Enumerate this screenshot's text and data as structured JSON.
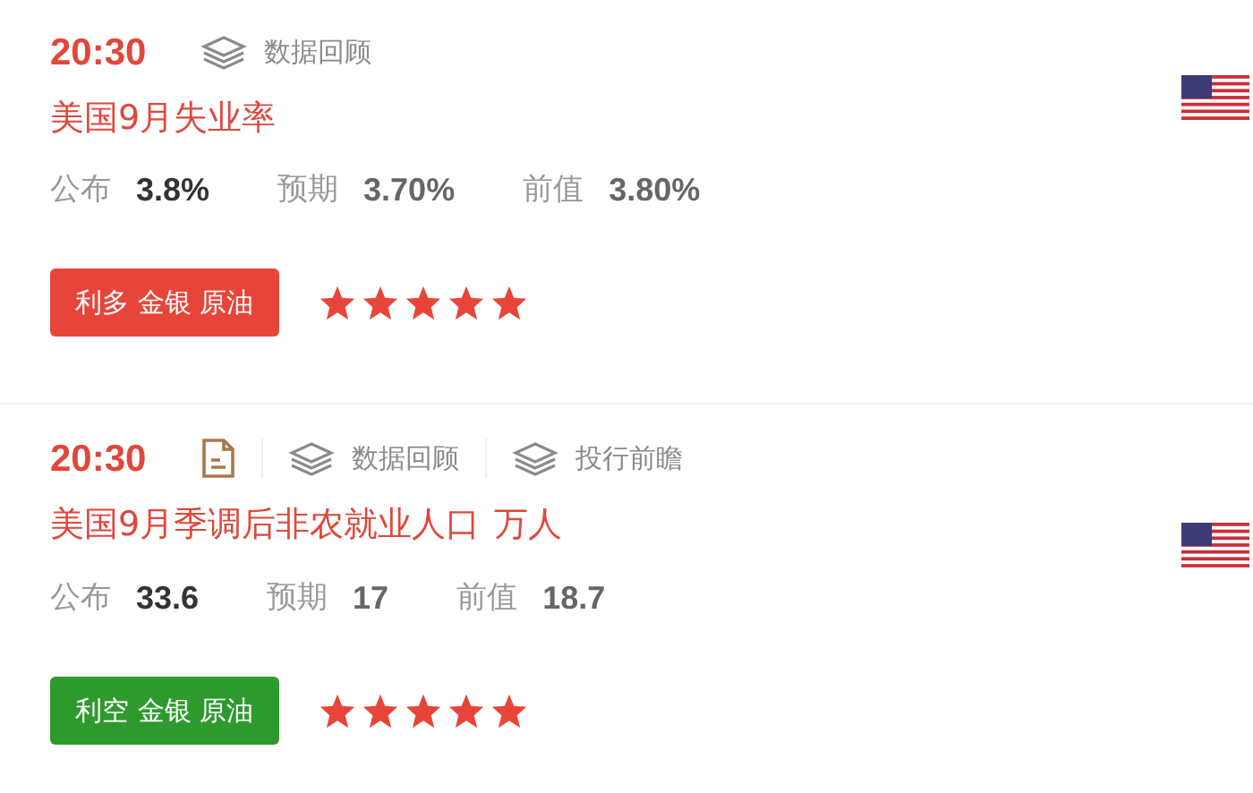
{
  "events": [
    {
      "time": "20:30",
      "links": [
        {
          "kind": "review",
          "label": "数据回顾"
        }
      ],
      "title": "美国9月失业率",
      "stats": [
        {
          "label": "公布",
          "value": "3.8%",
          "kind": "actual"
        },
        {
          "label": "预期",
          "value": "3.70%",
          "kind": "other"
        },
        {
          "label": "前值",
          "value": "3.80%",
          "kind": "other"
        }
      ],
      "tag": {
        "label": "利多 金银 原油",
        "kind": "bullish"
      },
      "stars": 5
    },
    {
      "time": "20:30",
      "links": [
        {
          "kind": "doc"
        },
        {
          "kind": "review",
          "label": "数据回顾"
        },
        {
          "kind": "review",
          "label": "投行前瞻"
        }
      ],
      "title": "美国9月季调后非农就业人口",
      "unit": "万人",
      "stats": [
        {
          "label": "公布",
          "value": "33.6",
          "kind": "actual"
        },
        {
          "label": "预期",
          "value": "17",
          "kind": "other"
        },
        {
          "label": "前值",
          "value": "18.7",
          "kind": "other"
        }
      ],
      "tag": {
        "label": "利空 金银 原油",
        "kind": "bearish"
      },
      "stars": 5
    }
  ]
}
